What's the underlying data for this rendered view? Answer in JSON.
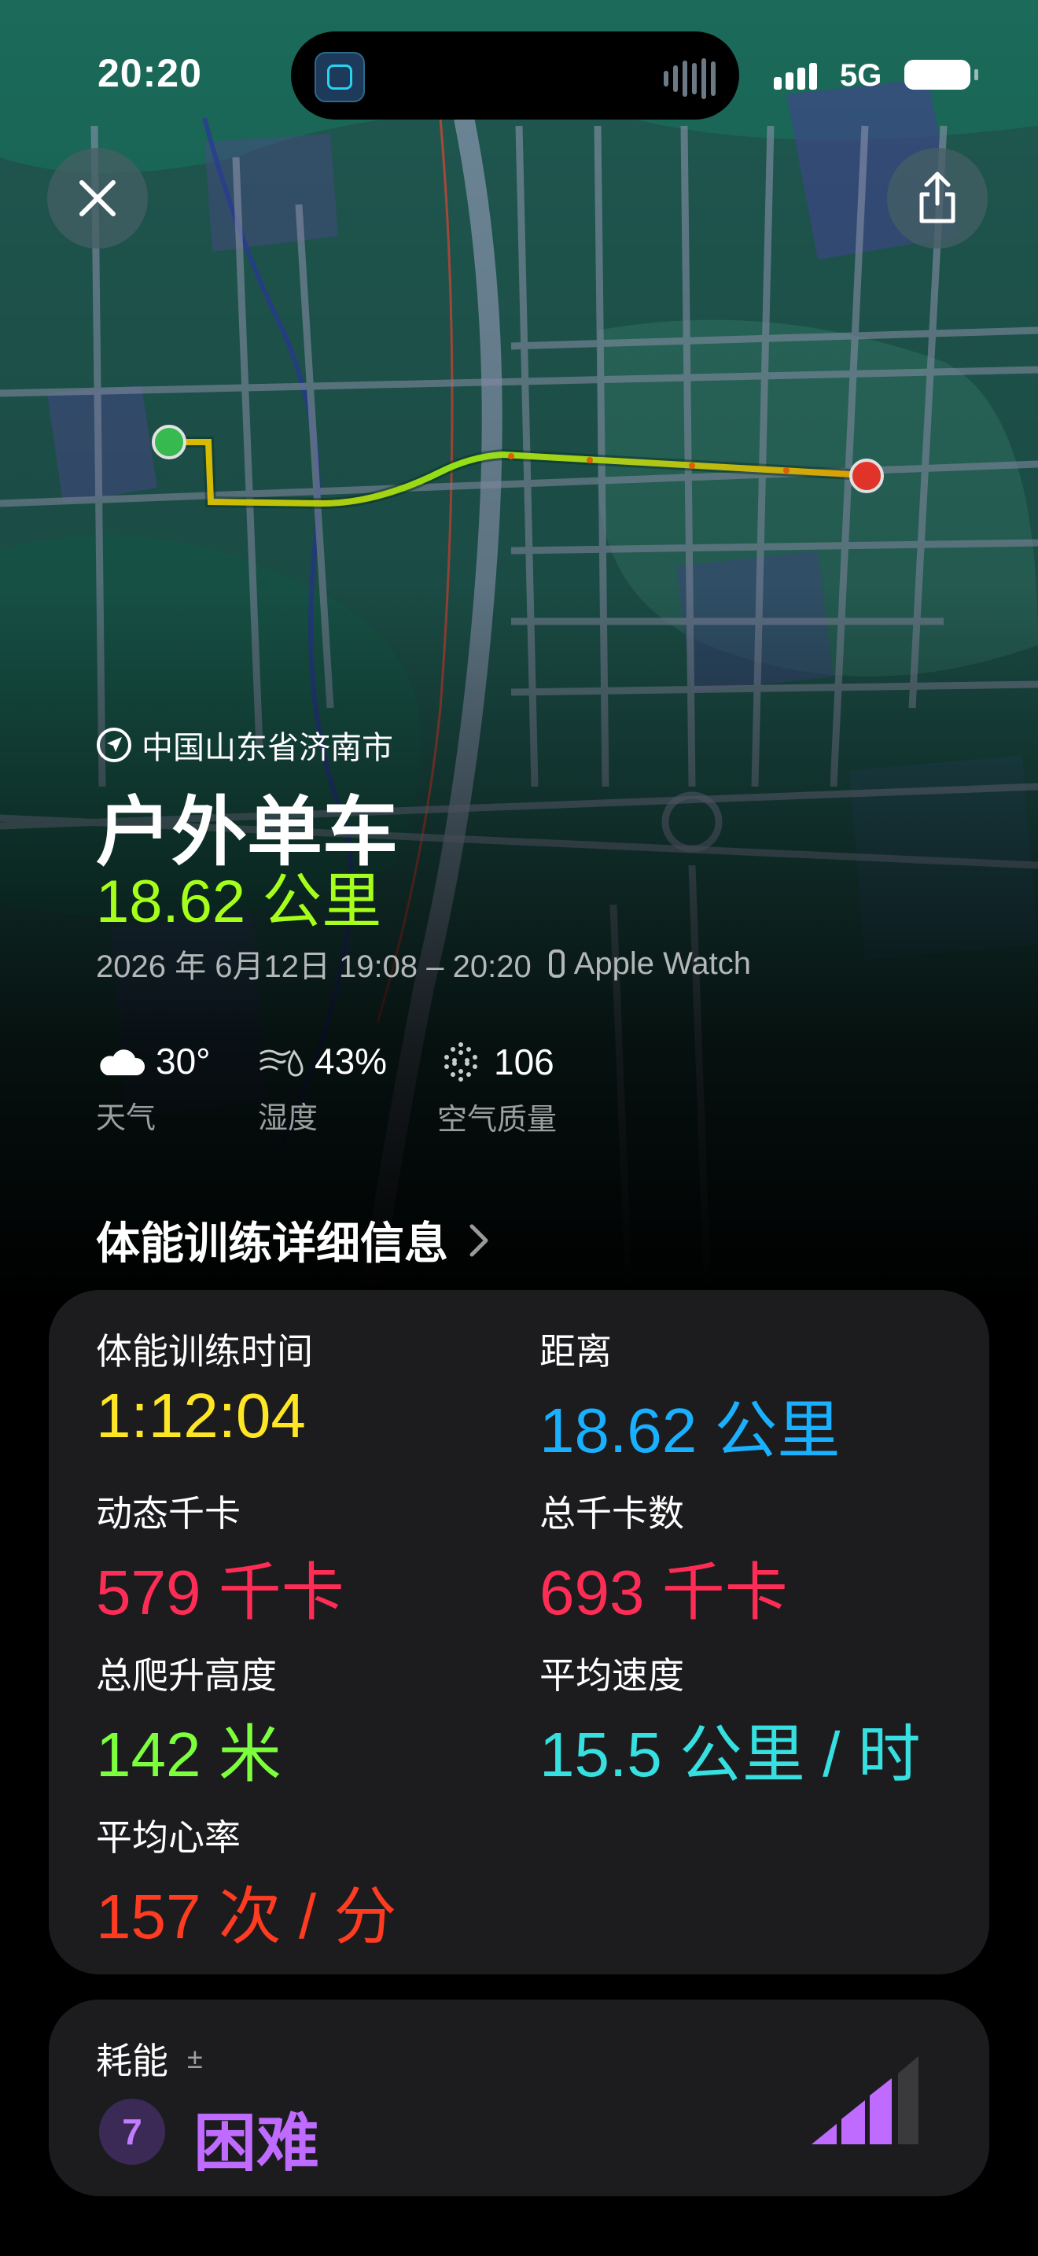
{
  "status_bar": {
    "time": "20:20",
    "network": "5G"
  },
  "map": {
    "start_color": "#3ed15a",
    "end_color": "#ff3b30",
    "route_colors": [
      "#a6ff1a",
      "#ffcc00",
      "#ff6a00"
    ]
  },
  "header": {
    "location": "中国山东省济南市",
    "title": "户外单车",
    "distance": "18.62 公里",
    "date": "2026 年 6月12日 19:08 – 20:20",
    "device": "Apple Watch"
  },
  "weather": {
    "temp": "30°",
    "temp_label": "天气",
    "humidity": "43%",
    "humidity_label": "湿度",
    "aqi": "106",
    "aqi_label": "空气质量"
  },
  "details": {
    "section_title": "体能训练详细信息",
    "metrics": [
      {
        "label": "体能训练时间",
        "value": "1:12:04",
        "color": "#ffe625"
      },
      {
        "label": "距离",
        "value": "18.62 公里",
        "color": "#18b0ff"
      },
      {
        "label": "动态千卡",
        "value": "579 千卡",
        "color": "#ff2d55"
      },
      {
        "label": "总千卡数",
        "value": "693 千卡",
        "color": "#ff2d55"
      },
      {
        "label": "总爬升高度",
        "value": "142 米",
        "color": "#7cff3c"
      },
      {
        "label": "平均速度",
        "value": "15.5 公里 / 时",
        "color": "#36e0e0"
      },
      {
        "label": "平均心率",
        "value": "157 次 / 分",
        "color": "#ff3b21"
      }
    ]
  },
  "effort": {
    "label": "耗能",
    "adjust": "±",
    "score": "7",
    "level": "困难",
    "level_fraction": 0.7,
    "color": "#bf6bff"
  }
}
